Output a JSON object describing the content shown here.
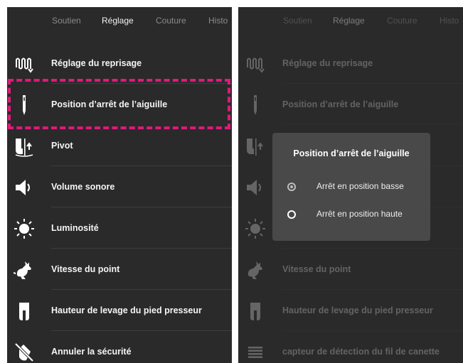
{
  "tabs": {
    "support": "Soutien",
    "settings": "Réglage",
    "sewing": "Couture",
    "history": "Histo"
  },
  "settings_items": [
    {
      "label": "Réglage du reprisage",
      "icon": "darning-icon"
    },
    {
      "label": "Position d’arrêt de l’aiguille",
      "icon": "needle-icon"
    },
    {
      "label": "Pivot",
      "icon": "pivot-icon"
    },
    {
      "label": "Volume sonore",
      "icon": "speaker-icon"
    },
    {
      "label": "Luminosité",
      "icon": "brightness-icon"
    },
    {
      "label": "Vitesse du point",
      "icon": "rabbit-icon"
    },
    {
      "label": "Hauteur de levage du pied presseur",
      "icon": "presser-foot-icon"
    },
    {
      "label": "Annuler la sécurité",
      "icon": "cancel-safety-icon"
    },
    {
      "label": "capteur de détection du fil de canette",
      "icon": "bobbin-sensor-icon"
    }
  ],
  "dialog": {
    "title": "Position d’arrêt de l’aiguille",
    "options": [
      {
        "label": "Arrêt en position basse",
        "selected": true
      },
      {
        "label": "Arrêt en position haute",
        "selected": false
      }
    ]
  },
  "colors": {
    "background": "#2a2a2a",
    "highlight": "#e0197b",
    "dialog": "#494949"
  }
}
